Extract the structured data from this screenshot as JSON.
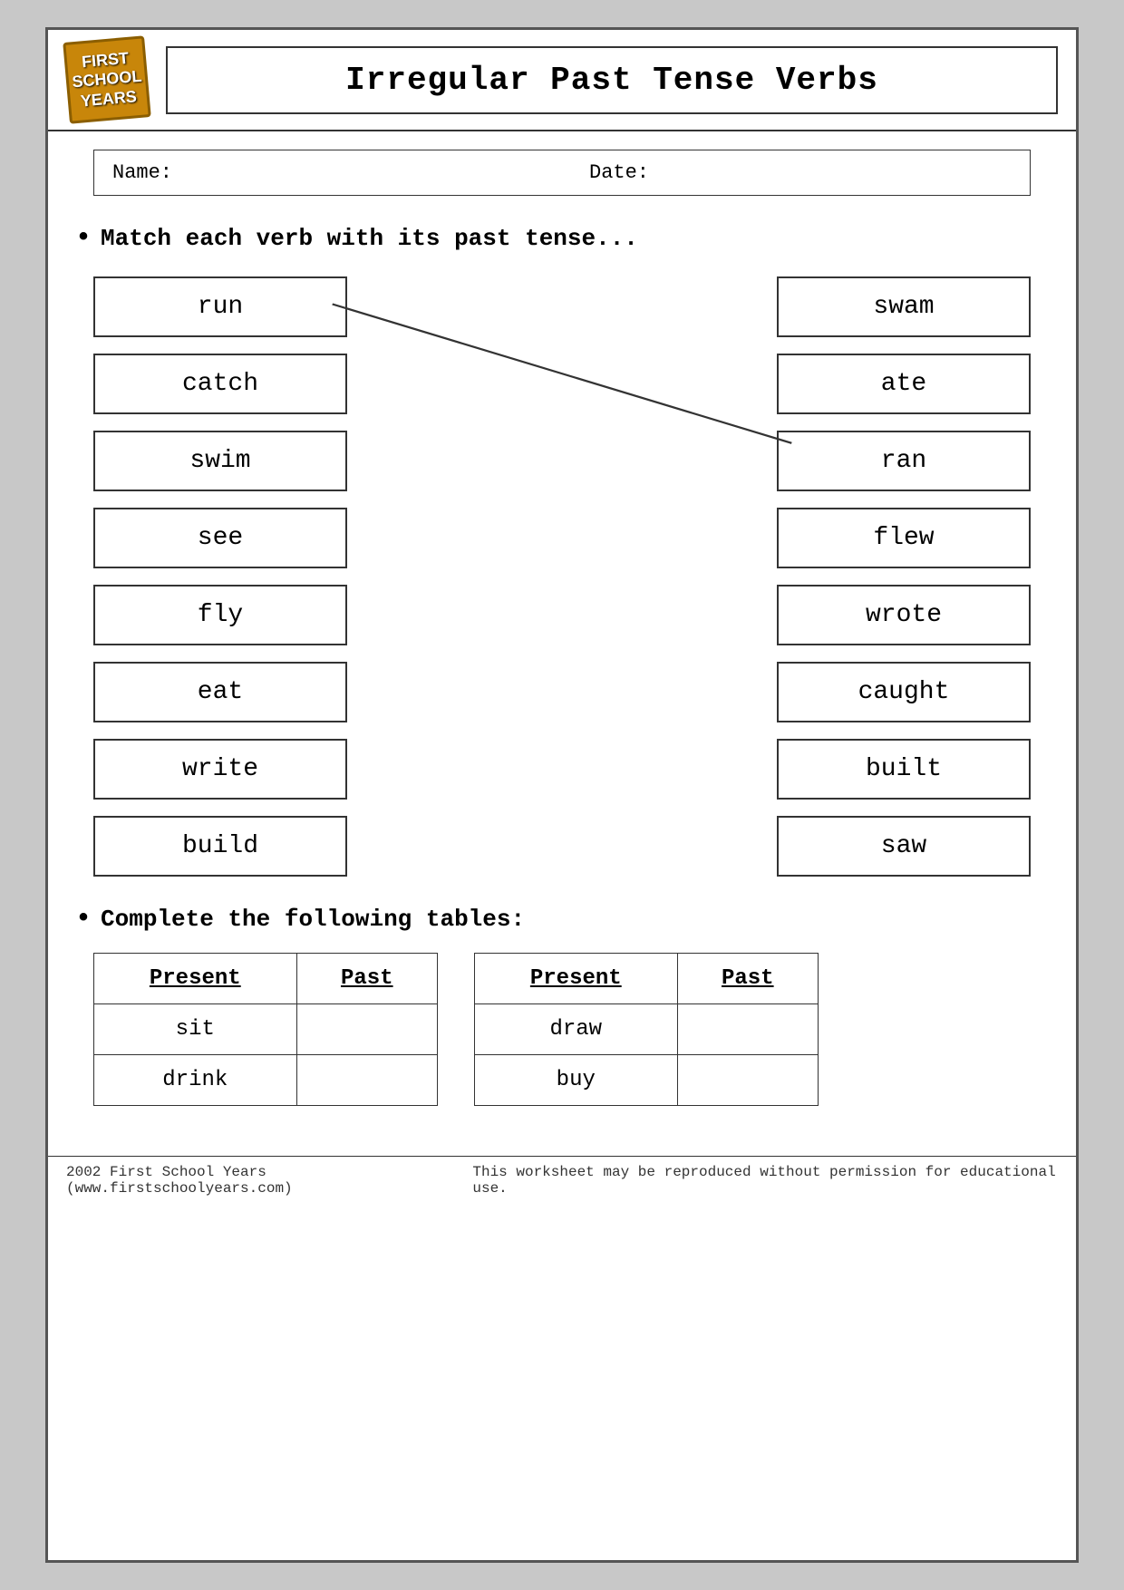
{
  "header": {
    "logo": {
      "line1": "FIRST",
      "line2": "SCHOOL",
      "line3": "YEARS"
    },
    "title": "Irregular Past Tense Verbs"
  },
  "nameDate": {
    "nameLabel": "Name:",
    "dateLabel": "Date:"
  },
  "instructions": {
    "match": "Match each verb with its past tense...",
    "complete": "Complete the following tables:"
  },
  "leftVerbs": [
    "run",
    "catch",
    "swim",
    "see",
    "fly",
    "eat",
    "write",
    "build"
  ],
  "rightVerbs": [
    "swam",
    "ate",
    "ran",
    "flew",
    "wrote",
    "caught",
    "built",
    "saw"
  ],
  "table1": {
    "headers": [
      "Present",
      "Past"
    ],
    "rows": [
      [
        "sit",
        ""
      ],
      [
        "drink",
        ""
      ]
    ]
  },
  "table2": {
    "headers": [
      "Present",
      "Past"
    ],
    "rows": [
      [
        "draw",
        ""
      ],
      [
        "buy",
        ""
      ]
    ]
  },
  "footer": {
    "left": "2002 First School Years  (www.firstschoolyears.com)",
    "right": "This worksheet may be reproduced without permission for educational use."
  }
}
